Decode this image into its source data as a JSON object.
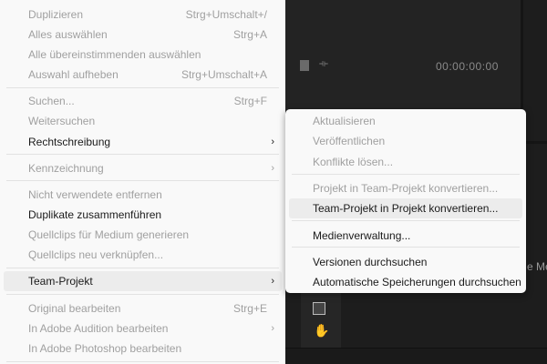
{
  "main_menu": [
    {
      "label": "Duplizieren",
      "shortcut": "Strg+Umschalt+/",
      "enabled": false
    },
    {
      "label": "Alles auswählen",
      "shortcut": "Strg+A",
      "enabled": false
    },
    {
      "label": "Alle übereinstimmenden auswählen",
      "enabled": false
    },
    {
      "label": "Auswahl aufheben",
      "shortcut": "Strg+Umschalt+A",
      "enabled": false
    },
    {
      "label": "Suchen...",
      "shortcut": "Strg+F",
      "enabled": false
    },
    {
      "label": "Weitersuchen",
      "enabled": false
    },
    {
      "label": "Rechtschreibung",
      "submenu": true,
      "enabled": true
    },
    {
      "label": "Kennzeichnung",
      "submenu": true,
      "enabled": false
    },
    {
      "label": "Nicht verwendete entfernen",
      "enabled": false
    },
    {
      "label": "Duplikate zusammenführen",
      "enabled": true
    },
    {
      "label": "Quellclips für Medium generieren",
      "enabled": false
    },
    {
      "label": "Quellclips neu verknüpfen...",
      "enabled": false
    },
    {
      "label": "Team-Projekt",
      "submenu": true,
      "enabled": true,
      "highlighted": true
    },
    {
      "label": "Original bearbeiten",
      "shortcut": "Strg+E",
      "enabled": false
    },
    {
      "label": "In Adobe Audition bearbeiten",
      "submenu": true,
      "enabled": false
    },
    {
      "label": "In Adobe Photoshop bearbeiten",
      "enabled": false
    }
  ],
  "submenu": [
    {
      "label": "Aktualisieren",
      "enabled": false
    },
    {
      "label": "Veröffentlichen",
      "enabled": false
    },
    {
      "label": "Konflikte lösen...",
      "enabled": false
    },
    {
      "label": "Projekt in Team-Projekt konvertieren...",
      "enabled": false
    },
    {
      "label": "Team-Projekt in Projekt konvertieren...",
      "enabled": true,
      "highlighted": true
    },
    {
      "label": "Medienverwaltung...",
      "enabled": true
    },
    {
      "label": "Versionen durchsuchen",
      "enabled": true
    },
    {
      "label": "Automatische Speicherungen durchsuchen",
      "enabled": true
    }
  ],
  "background": {
    "timecode": "00:00:00:00",
    "partial_label": "e Med"
  }
}
